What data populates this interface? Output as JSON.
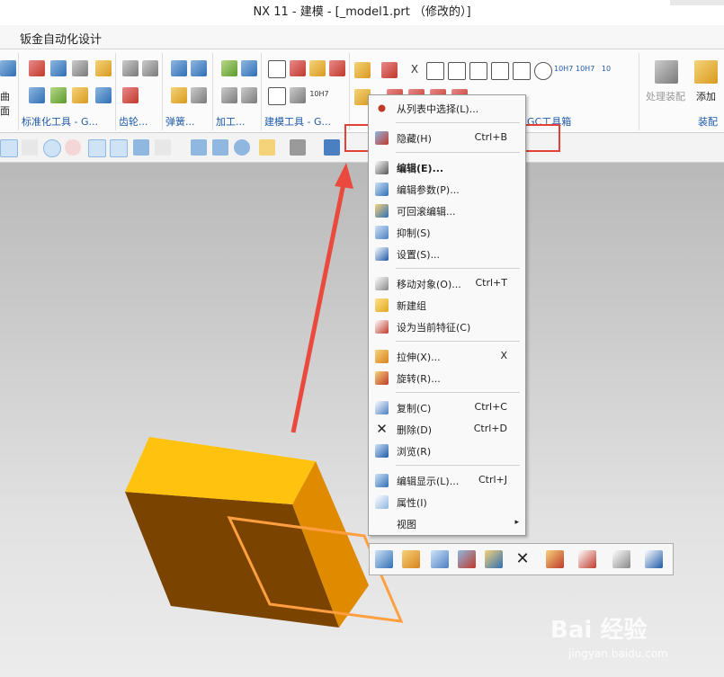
{
  "window": {
    "title": "NX 11 - 建模 - [_model1.prt （修改的）]"
  },
  "menu_tab": "钣金自动化设计",
  "ribbon": {
    "groups": [
      {
        "label": "标准化工具 - G...",
        "dropdown": "▾"
      },
      {
        "label": "齿轮...",
        "dropdown": "▾"
      },
      {
        "label": "弹簧...",
        "dropdown": "▾"
      },
      {
        "label": "加工...",
        "dropdown": "▾"
      },
      {
        "label": "建模工具 - G...",
        "dropdown": "▾"
      },
      {
        "label": "GC工具箱"
      },
      {
        "label": "装配"
      }
    ],
    "left_cut_label": "曲面",
    "assembly_buttons": {
      "process": "处理装配",
      "add": "添加"
    },
    "tolerance_labels": [
      "X",
      "10H7",
      "10H7",
      "10H7",
      "10"
    ]
  },
  "context_menu": {
    "items": [
      {
        "label": "从列表中选择(L)...",
        "shortcut": "",
        "icon": "crosshair-icon"
      },
      {
        "label": "隐藏(H)",
        "shortcut": "Ctrl+B",
        "icon": "hide-icon"
      },
      {
        "label": "编辑(E)...",
        "shortcut": "",
        "icon": "edit-icon"
      },
      {
        "label": "编辑参数(P)...",
        "shortcut": "",
        "icon": "edit-parameters-icon"
      },
      {
        "label": "可回滚编辑...",
        "shortcut": "",
        "icon": "rollback-edit-icon"
      },
      {
        "label": "抑制(S)",
        "shortcut": "",
        "icon": "suppress-icon"
      },
      {
        "label": "设置(S)...",
        "shortcut": "",
        "icon": "settings-icon"
      },
      {
        "label": "移动对象(O)...",
        "shortcut": "Ctrl+T",
        "icon": "move-object-icon"
      },
      {
        "label": "新建组",
        "shortcut": "",
        "icon": "new-group-folder-icon"
      },
      {
        "label": "设为当前特征(C)",
        "shortcut": "",
        "icon": "make-current-feature-icon"
      },
      {
        "label": "拉伸(X)...",
        "shortcut": "X",
        "icon": "extrude-icon"
      },
      {
        "label": "旋转(R)...",
        "shortcut": "",
        "icon": "revolve-icon"
      },
      {
        "label": "复制(C)",
        "shortcut": "Ctrl+C",
        "icon": "copy-icon"
      },
      {
        "label": "删除(D)",
        "shortcut": "Ctrl+D",
        "icon": "delete-icon"
      },
      {
        "label": "浏览(R)",
        "shortcut": "",
        "icon": "browse-icon"
      },
      {
        "label": "编辑显示(L)...",
        "shortcut": "Ctrl+J",
        "icon": "edit-display-icon"
      },
      {
        "label": "属性(I)",
        "shortcut": "",
        "icon": "properties-icon"
      },
      {
        "label": "视图",
        "shortcut": "",
        "icon": "",
        "submenu": "▸"
      }
    ]
  },
  "watermark": {
    "logo": "Bai 经验",
    "url": "jingyan.baidu.com"
  },
  "colors": {
    "highlight": "#e2413a",
    "arrow": "#ea4a3d",
    "block_top": "#ffc20f",
    "block_front": "#7a4400",
    "block_side": "#e08a00",
    "sketch_outline": "#ff9f40"
  }
}
